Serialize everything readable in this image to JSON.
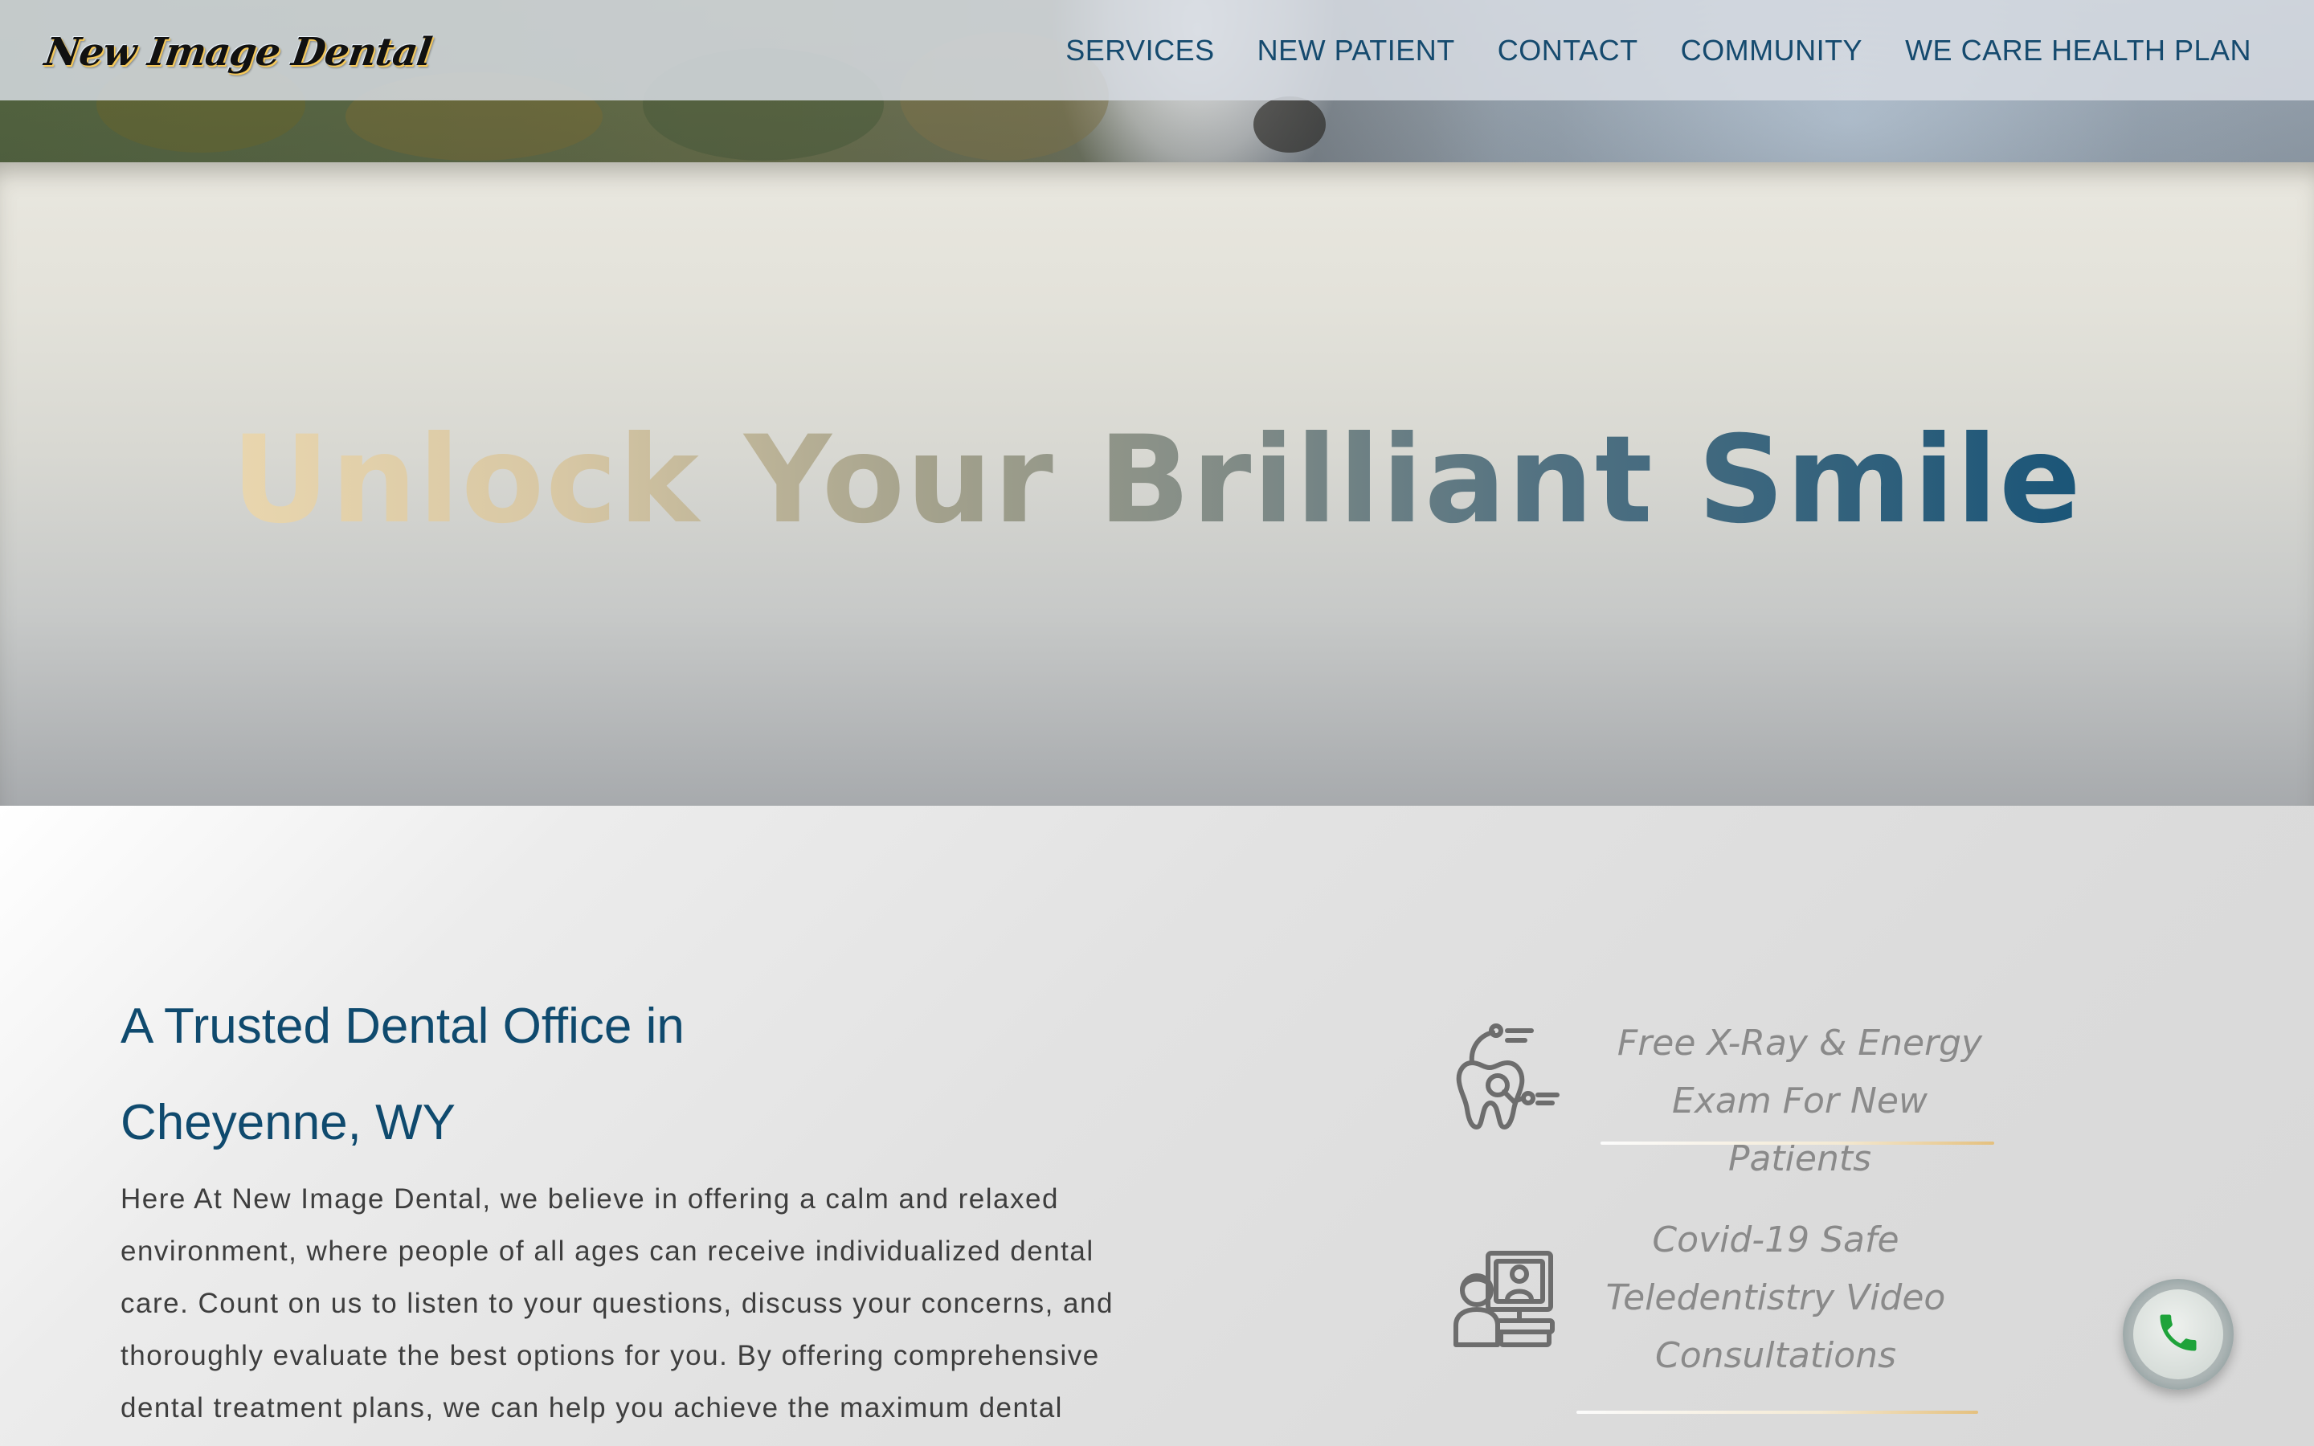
{
  "header": {
    "logo_text": "New Image Dental",
    "nav": [
      {
        "label": "SERVICES"
      },
      {
        "label": "NEW PATIENT"
      },
      {
        "label": "CONTACT"
      },
      {
        "label": "COMMUNITY"
      },
      {
        "label": "WE CARE HEALTH PLAN"
      }
    ]
  },
  "hero": {
    "title": "Unlock Your Brilliant Smile"
  },
  "intro": {
    "title_line1": "A Trusted Dental Office in",
    "title_line2": "Cheyenne, WY",
    "body": "Here At New Image Dental, we believe in offering a calm and relaxed environment, where people of all ages can receive individualized dental care. Count on us to listen to your questions, discuss your concerns, and thoroughly evaluate the best options for you. By offering comprehensive dental treatment plans, we can help you achieve the maximum dental health benefits."
  },
  "features": [
    {
      "icon": "tooth-exam-icon",
      "line1": "Free X-Ray & Energy",
      "line2": "Exam For New Patients"
    },
    {
      "icon": "teledentistry-video-icon",
      "line1": "Covid-19 Safe",
      "line2": "Teledentistry Video",
      "line3": "Consultations"
    }
  ],
  "floating": {
    "icon": "phone-icon"
  },
  "colors": {
    "brand_blue": "#154a6e",
    "phone_green": "#1ea33a",
    "feature_gray": "#8a8a8a"
  }
}
